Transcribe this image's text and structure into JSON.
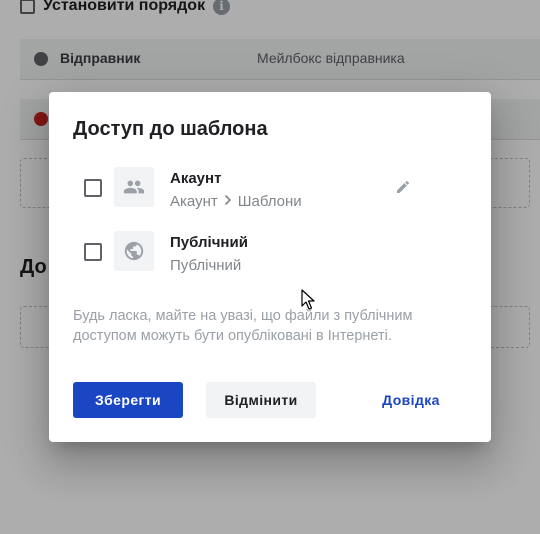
{
  "background": {
    "order_checkbox_label": "Установити порядок",
    "rows": [
      {
        "label": "Відправник",
        "value": "Мейлбокс відправника",
        "dot_color": "#5f6368"
      },
      {
        "dot_color": "#c5221f"
      }
    ],
    "section_heading": "До"
  },
  "dialog": {
    "title": "Доступ до шаблона",
    "options": [
      {
        "title": "Акаунт",
        "path_root": "Акаунт",
        "path_leaf": "Шаблони",
        "icon": "people-icon",
        "checked": false,
        "editable": true
      },
      {
        "title": "Публічний",
        "subtitle": "Публічний",
        "icon": "globe-icon",
        "checked": false
      }
    ],
    "notice": "Будь ласка, майте на увазі, що файли з публічним доступом можуть бути опубліковані в Інтернеті.",
    "buttons": {
      "save": "Зберегти",
      "cancel": "Відмінити",
      "help": "Довідка"
    }
  },
  "colors": {
    "primary": "#1a46c4",
    "scrim": "rgba(0,0,0,0.32)"
  }
}
